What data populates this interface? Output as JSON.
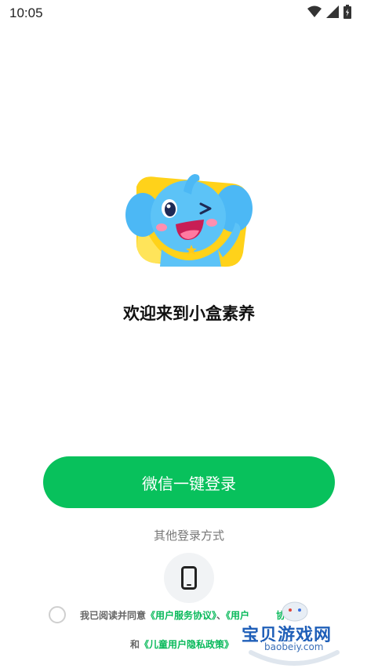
{
  "status": {
    "time": "10:05"
  },
  "welcome": "欢迎来到小盒素养",
  "wechat_button": "微信一键登录",
  "other_methods": "其他登录方式",
  "agreement": {
    "prefix": "我已阅读并同意",
    "service": "《用户服务协议》",
    "sep": "、",
    "user_partial": "《用户",
    "user_suffix": "协议》",
    "and": "和",
    "privacy": "《儿童用户隐私政策》"
  },
  "watermark": {
    "title": "宝贝游戏网",
    "domain": "baobeiy.com"
  },
  "colors": {
    "accent": "#08c15c",
    "link": "#08b95a"
  },
  "icons": [
    "wifi-icon",
    "signal-icon",
    "battery-icon",
    "phone-icon",
    "mascot-elephant"
  ]
}
